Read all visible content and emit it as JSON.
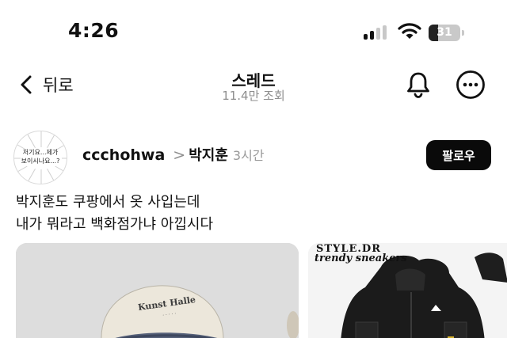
{
  "status_bar": {
    "time": "4:26",
    "battery_level": "31",
    "signal_bars_active": 2,
    "signal_bars_total": 4
  },
  "nav": {
    "back_label": "뒤로",
    "title": "스레드",
    "subtitle": "11.4만 조회",
    "bell_icon": "bell-icon",
    "more_icon": "more-horizontal-icon"
  },
  "post": {
    "avatar_text": "저기요...제가\n보이시나요...?",
    "username": "ccchohwa",
    "separator": ">",
    "referenced_name": "박지훈",
    "time": "3시간",
    "follow_label": "팔로우",
    "text_lines": [
      "박지훈도 쿠팡에서 옷 사입는데",
      "내가 뭐라고 백화점가냐 아낍시다"
    ]
  },
  "images": {
    "photo_cap_text": "Kunst Halle",
    "product_brand": "STYLE.DR",
    "product_tagline": "trendy sneakers"
  },
  "colors": {
    "text": "#111111",
    "muted": "#8e8e8e",
    "follow_bg": "#0a0a0a",
    "follow_text": "#ffffff"
  }
}
